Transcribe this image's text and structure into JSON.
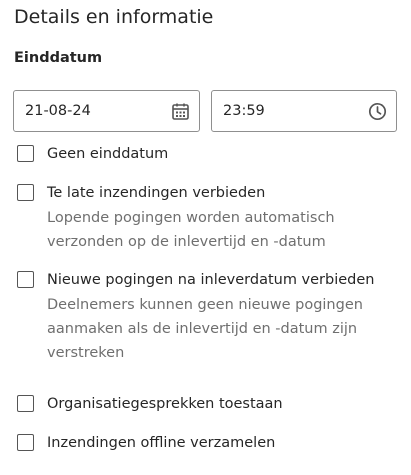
{
  "section": {
    "title": "Details en informatie",
    "due_label": "Einddatum"
  },
  "due": {
    "date_value": "21-08-24",
    "time_value": "23:59",
    "date_icon": "calendar-icon",
    "time_icon": "clock-icon"
  },
  "options": {
    "no_due_date": {
      "label": "Geen einddatum",
      "checked": false
    },
    "prohibit_late": {
      "label": "Te late inzendingen verbieden",
      "description": "Lopende pogingen worden automatisch verzonden op de inlevertijd en -datum",
      "checked": false
    },
    "prohibit_new": {
      "label": "Nieuwe pogingen na inleverdatum verbieden",
      "description": "Deelnemers kunnen geen nieuwe pogingen aanmaken als de inlevertijd en -datum zijn verstreken",
      "checked": false
    },
    "conversations": {
      "label": "Organisatiegesprekken toestaan",
      "checked": false
    },
    "offline": {
      "label": "Inzendingen offline verzamelen",
      "checked": false
    }
  },
  "colors": {
    "text": "#262626",
    "secondary_text": "#6f6f6f",
    "border": "#8f8f8f"
  }
}
